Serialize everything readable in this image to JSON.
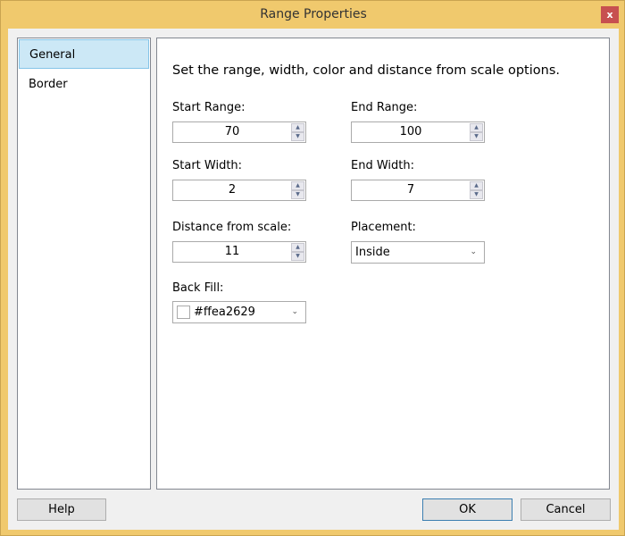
{
  "title": "Range Properties",
  "close_label": "x",
  "nav": [
    {
      "label": "General",
      "selected": true
    },
    {
      "label": "Border",
      "selected": false
    }
  ],
  "description": "Set the range, width, color and distance from scale options.",
  "fields": {
    "start_range": {
      "label": "Start Range:",
      "value": "70"
    },
    "end_range": {
      "label": "End Range:",
      "value": "100"
    },
    "start_width": {
      "label": "Start Width:",
      "value": "2"
    },
    "end_width": {
      "label": "End Width:",
      "value": "7"
    },
    "distance": {
      "label": "Distance from scale:",
      "value": "11"
    },
    "placement": {
      "label": "Placement:",
      "value": "Inside"
    },
    "back_fill": {
      "label": "Back Fill:",
      "value": "#ffea2629"
    }
  },
  "buttons": {
    "help": "Help",
    "ok": "OK",
    "cancel": "Cancel"
  }
}
